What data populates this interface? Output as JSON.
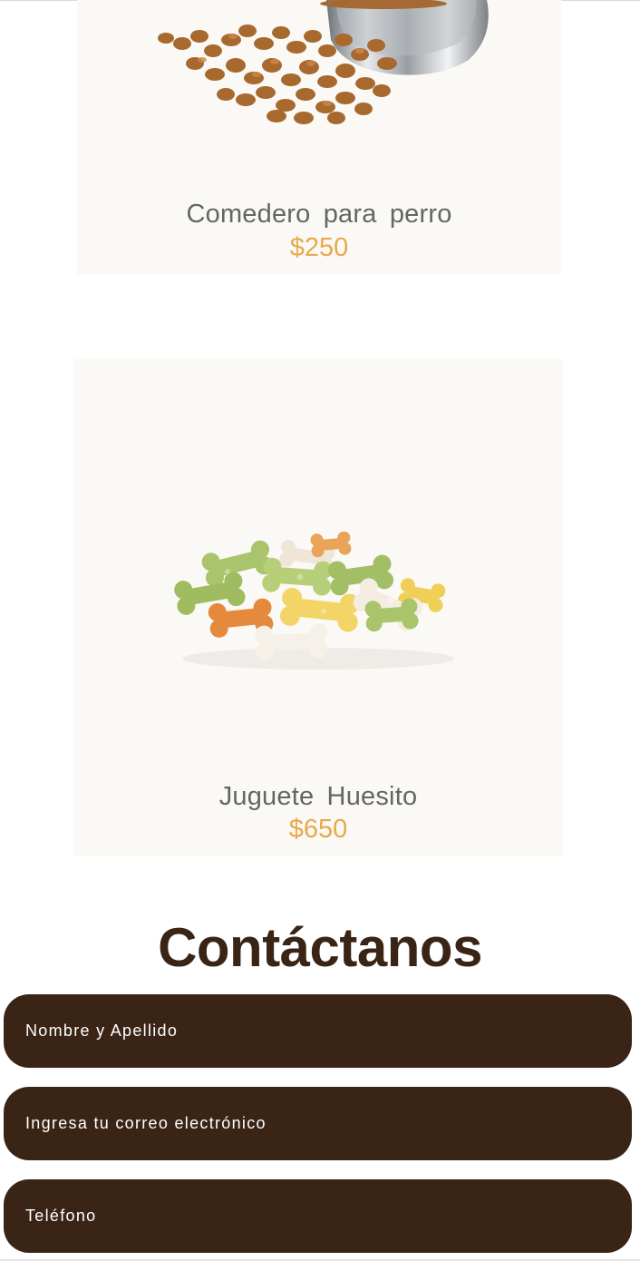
{
  "products": [
    {
      "name": "Comedero para perro",
      "price": "$250",
      "image_icon": "dog-food-bowl-image"
    },
    {
      "name": "Juguete Huesito",
      "price": "$650",
      "image_icon": "bone-biscuits-image"
    }
  ],
  "contact": {
    "title": "Contáctanos",
    "name_placeholder": "Nombre y Apellido",
    "email_placeholder": "Ingresa tu correo electrónico",
    "phone_placeholder": "Teléfono"
  },
  "colors": {
    "brand_dark": "#3a2416",
    "price_accent": "#e9a84b",
    "card_bg": "#fbf9f5",
    "product_text": "#656565"
  }
}
